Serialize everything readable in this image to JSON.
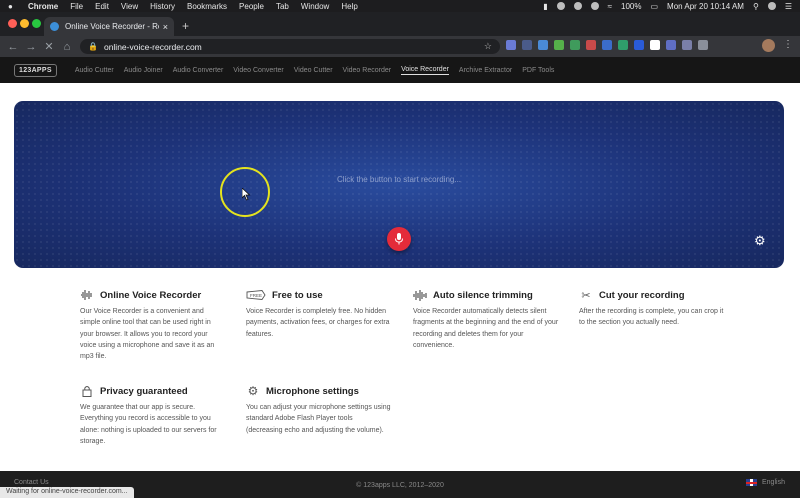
{
  "menubar": {
    "app": "Chrome",
    "items": [
      "File",
      "Edit",
      "View",
      "History",
      "Bookmarks",
      "People",
      "Tab",
      "Window",
      "Help"
    ],
    "battery": "100%",
    "clock": "Mon Apr 20  10:14 AM"
  },
  "browser": {
    "tab_title": "Online Voice Recorder - Record",
    "url": "online-voice-recorder.com",
    "status": "Waiting for online-voice-recorder.com..."
  },
  "appnav": {
    "logo": "123APPS",
    "links": [
      "Audio Cutter",
      "Audio Joiner",
      "Audio Converter",
      "Video Converter",
      "Video Cutter",
      "Video Recorder",
      "Voice Recorder",
      "Archive Extractor",
      "PDF Tools"
    ],
    "active": "Voice Recorder"
  },
  "recorder": {
    "hint": "Click the button to start recording..."
  },
  "features": [
    {
      "title": "Online Voice Recorder",
      "icon": "waveform-icon",
      "desc": "Our Voice Recorder is a convenient and simple online tool that can be used right in your browser. It allows you to record your voice using a microphone and save it as an mp3 file."
    },
    {
      "title": "Free to use",
      "icon": "free-tag-icon",
      "desc": "Voice Recorder is completely free. No hidden payments, activation fees, or charges for extra features."
    },
    {
      "title": "Auto silence trimming",
      "icon": "audio-bars-icon",
      "desc": "Voice Recorder automatically detects silent fragments at the beginning and the end of your recording and deletes them for your convenience."
    },
    {
      "title": "Cut your recording",
      "icon": "scissors-icon",
      "desc": "After the recording is complete, you can crop it to the section you actually need."
    },
    {
      "title": "Privacy guaranteed",
      "icon": "lock-icon",
      "desc": "We guarantee that our app is secure. Everything you record is accessible to you alone: nothing is uploaded to our servers for storage."
    },
    {
      "title": "Microphone settings",
      "icon": "gear-icon",
      "desc": "You can adjust your microphone settings using standard Adobe Flash Player tools (decreasing echo and adjusting the volume)."
    }
  ],
  "footer": {
    "contact": "Contact Us",
    "copyright": "© 123apps LLC, 2012–2020",
    "language": "English"
  },
  "colors": {
    "record_button": "#e42b3a",
    "recorder_bg": "#1d3278",
    "cursor_highlight": "#e4e31e"
  }
}
